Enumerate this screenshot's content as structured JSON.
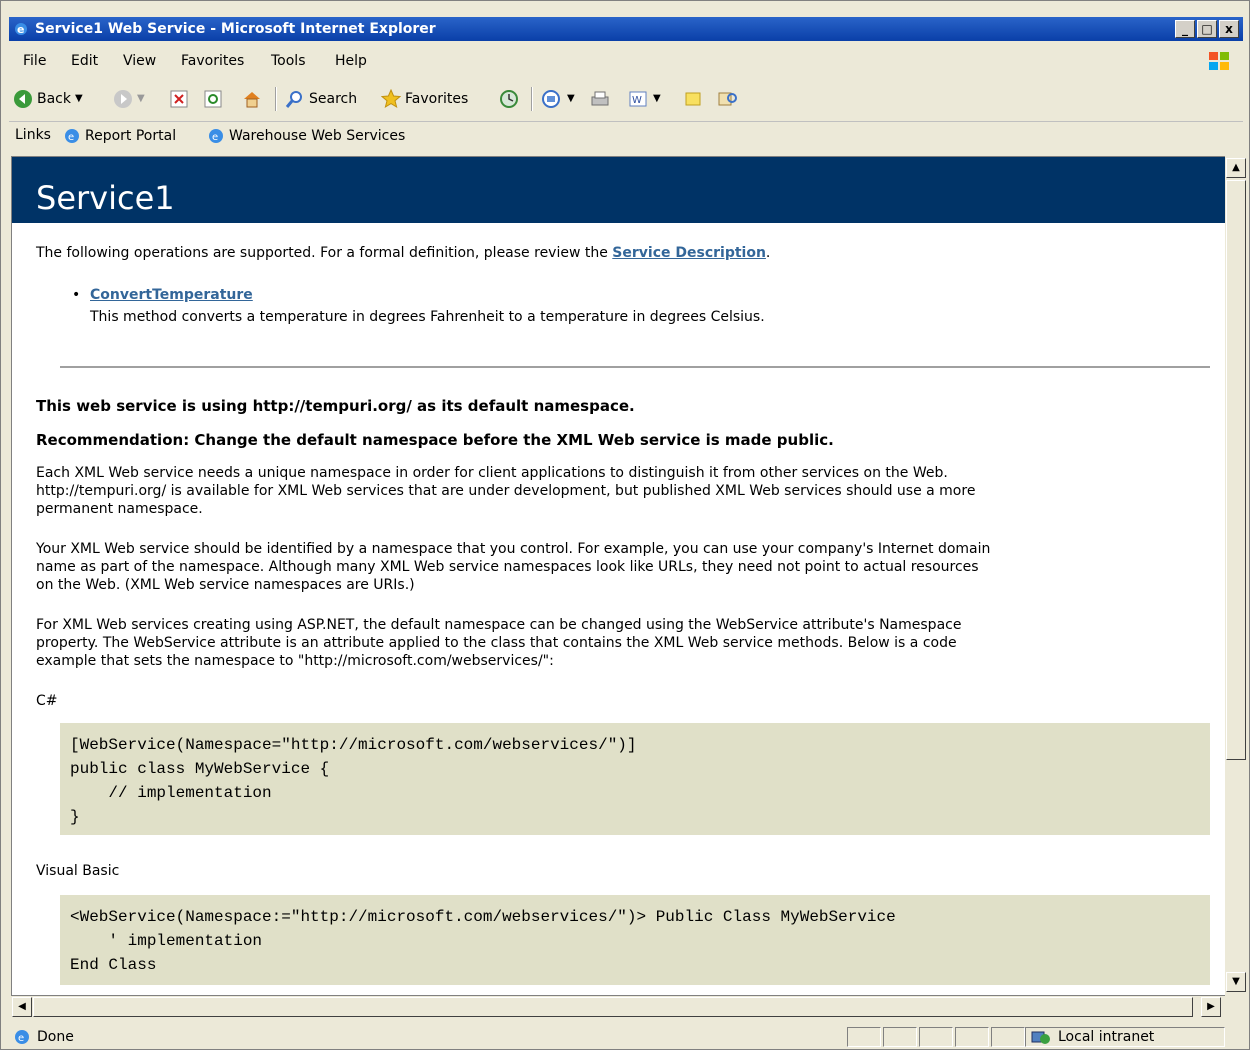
{
  "window": {
    "title": "Service1 Web Service - Microsoft Internet Explorer",
    "controls": [
      "_",
      "□",
      "x"
    ]
  },
  "menu": [
    "File",
    "Edit",
    "View",
    "Favorites",
    "Tools",
    "Help"
  ],
  "toolbar": {
    "back": "Back",
    "search": "Search",
    "favorites": "Favorites"
  },
  "links": {
    "label": "Links",
    "items": [
      "Report Portal",
      "Warehouse Web Services"
    ]
  },
  "page": {
    "heading": "Service1",
    "intro_prefix": "The following operations are supported. For a formal definition, please review the ",
    "intro_link": "Service Description",
    "intro_suffix": ".",
    "operation": {
      "name": "ConvertTemperature",
      "description": "This method converts a temperature in degrees Fahrenheit to a temperature in degrees Celsius."
    },
    "ns_heading": "This web service is using http://tempuri.org/ as its default namespace.",
    "rec_heading": "Recommendation: Change the default namespace before the XML Web service is made public.",
    "para1_line1": "Each XML Web service needs a unique namespace in order for client applications to distinguish it from other services on the Web.",
    "para1_line2": "http://tempuri.org/ is available for XML Web services that are under development, but published XML Web services should use a more",
    "para1_line3": "permanent namespace.",
    "para2_line1": "Your XML Web service should be identified by a namespace that you control. For example, you can use your company's Internet domain",
    "para2_line2": "name as part of the namespace. Although many XML Web service namespaces look like URLs, they need not point to actual resources",
    "para2_line3": "on the Web. (XML Web service namespaces are URIs.)",
    "para3_line1": "For XML Web services creating using ASP.NET, the default namespace can be changed using the WebService attribute's Namespace",
    "para3_line2": "property. The WebService attribute is an attribute applied to the class that contains the XML Web service methods. Below is a code",
    "para3_line3": "example that sets the namespace to \"http://microsoft.com/webservices/\":",
    "csharp_label": "C#",
    "csharp_code": "[WebService(Namespace=\"http://microsoft.com/webservices/\")]\npublic class MyWebService {\n    // implementation\n}",
    "vb_label": "Visual Basic",
    "vb_code": "<WebService(Namespace:=\"http://microsoft.com/webservices/\")> Public Class MyWebService\n    ' implementation\nEnd Class"
  },
  "status": {
    "text": "Done",
    "zone": "Local intranet"
  },
  "colors": {
    "banner": "#003366",
    "link": "#336699",
    "code_bg": "#e0e0c8",
    "titlebar": "#0a3fa8"
  }
}
